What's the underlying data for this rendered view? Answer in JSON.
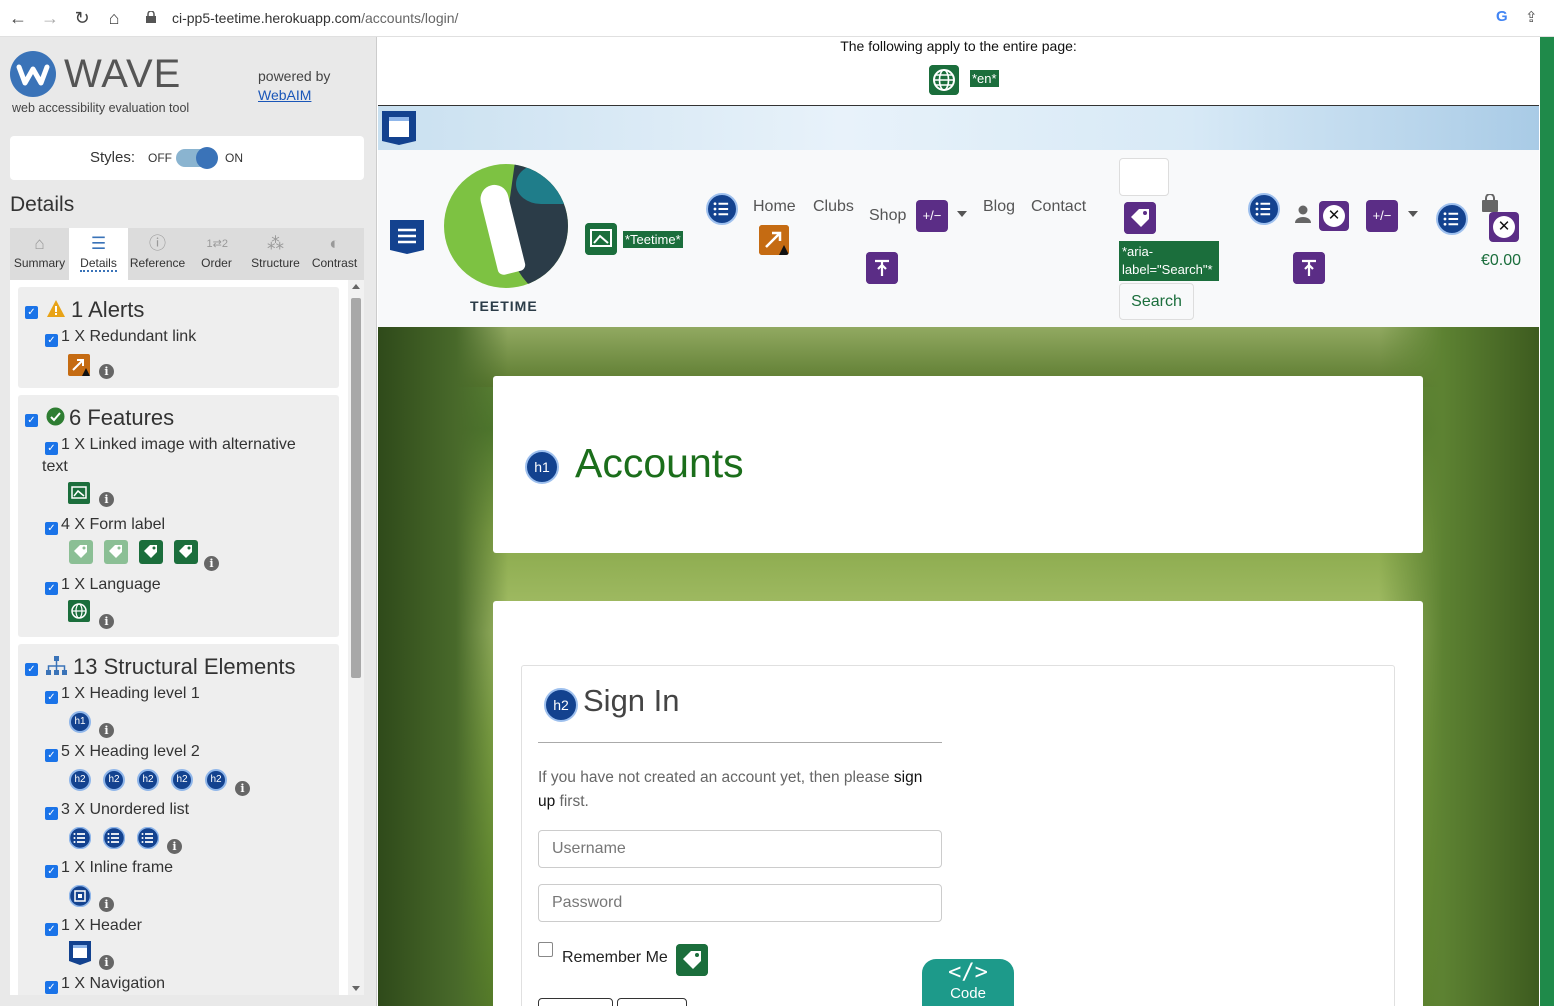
{
  "browser": {
    "back": "←",
    "forward": "→",
    "reload": "↻",
    "home": "⌂",
    "url_host": "ci-pp5-teetime.herokuapp.com",
    "url_path": "/accounts/login/",
    "google": "G",
    "share": "⇪"
  },
  "wave": {
    "name": "WAVE",
    "subtitle": "web accessibility evaluation tool",
    "powered_by": "powered by",
    "webaim": "WebAIM",
    "styles_label": "Styles:",
    "styles_off": "OFF",
    "styles_on": "ON",
    "details_title": "Details",
    "tabs": [
      {
        "label": "Summary",
        "icon": "home-icon"
      },
      {
        "label": "Details",
        "icon": "list-icon"
      },
      {
        "label": "Reference",
        "icon": "info-icon"
      },
      {
        "label": "Order",
        "icon": "order-icon"
      },
      {
        "label": "Structure",
        "icon": "structure-icon"
      },
      {
        "label": "Contrast",
        "icon": "contrast-icon"
      }
    ],
    "alerts": {
      "title": "1 Alerts",
      "items": [
        {
          "label": "1 X Redundant link"
        }
      ]
    },
    "features": {
      "title": "6 Features",
      "items": [
        {
          "label": "1 X Linked image with alternative",
          "label2": "text"
        },
        {
          "label": "4 X Form label"
        },
        {
          "label": "1 X Language"
        }
      ]
    },
    "structure": {
      "title": "13 Structural Elements",
      "items": [
        {
          "label": "1 X Heading level 1",
          "icon_text": "h1"
        },
        {
          "label": "5 X Heading level 2",
          "icon_text": "h2"
        },
        {
          "label": "3 X Unordered list"
        },
        {
          "label": "1 X Inline frame"
        },
        {
          "label": "1 X Header"
        },
        {
          "label": "1 X Navigation"
        }
      ]
    },
    "info": "i"
  },
  "page": {
    "banner_text": "The following apply to the entire page:",
    "lang_tag": "*en*",
    "alt_tag": "*Teetime*",
    "logo_text": "TEETIME",
    "nav": {
      "home": "Home",
      "clubs": "Clubs",
      "shop": "Shop",
      "blog": "Blog",
      "contact": "Contact"
    },
    "aria_icon_text": "+/−",
    "aria_label_tag": "*aria-label=\"Search\"*",
    "search_button": "Search",
    "cart_total": "€0.00",
    "accounts_title": "Accounts",
    "h1_icon": "h1",
    "h2_icon": "h2",
    "signin_title": "Sign In",
    "signin_text_before": "If you have not created an account yet, then please ",
    "signin_link": "sign up",
    "signin_text_after": " first.",
    "username_placeholder": "Username",
    "password_placeholder": "Password",
    "remember_me": "Remember Me",
    "code_glyph": "</>",
    "code_label": "Code"
  }
}
